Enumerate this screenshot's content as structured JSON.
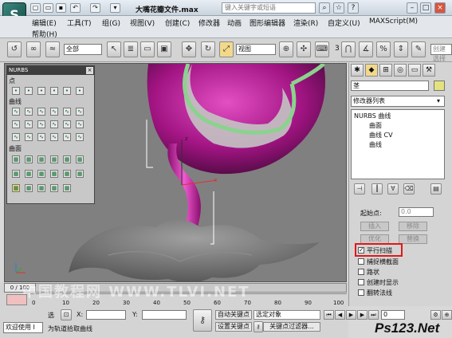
{
  "title_bar": {
    "app_logo": "S",
    "document_title": "大嘴花瓣文件.max",
    "search_placeholder": "键入关键字或短语"
  },
  "menu": {
    "items": [
      "编辑(E)",
      "工具(T)",
      "组(G)",
      "视图(V)",
      "创建(C)",
      "修改器",
      "动画",
      "图形编辑器",
      "渲染(R)",
      "自定义(U)",
      "MAXScript(M)",
      "帮助(H)"
    ]
  },
  "toolbar": {
    "selection_filter": "全部",
    "reference_coord": "视图",
    "snap_value": "3",
    "named_sets_placeholder": "创建选择集"
  },
  "nurbs_panel": {
    "title": "NURBS",
    "close": "×",
    "group_point": "点",
    "group_curve": "曲线",
    "group_surface": "曲面"
  },
  "viewport": {
    "axis_x": "x",
    "axis_y": "y",
    "axis_z": "z"
  },
  "command_panel": {
    "object_name": "茎",
    "object_color": "#e4e27e",
    "modifier_list": "修改器列表",
    "stack_root": "NURBS 曲线",
    "stack_children": [
      "曲面",
      "曲线 CV",
      "曲线"
    ],
    "start_point_label": "起始点:",
    "start_point_value": "0.0",
    "insert_button": "插入",
    "remove_button": "移除",
    "optimize_button": "优化",
    "replace_button": "替换",
    "options": [
      {
        "label": "平行扫描",
        "checked": true,
        "highlighted": true
      },
      {
        "label": "捕捉横截面",
        "checked": false
      },
      {
        "label": "路状",
        "checked": false
      },
      {
        "label": "创建时显示",
        "checked": false
      },
      {
        "label": "翻转法线",
        "checked": false
      }
    ]
  },
  "timeline": {
    "slider_label": "0 / 100",
    "ticks": [
      "0",
      "10",
      "20",
      "30",
      "40",
      "50",
      "60",
      "70",
      "80",
      "90",
      "100"
    ]
  },
  "status_bar": {
    "welcome": "欢迎使用 I",
    "selected_label": "选",
    "x_label": "X:",
    "y_label": "Y:",
    "auto_key": "自动关键点",
    "selected_object": "选定对象",
    "set_key": "设置关键点",
    "key_filters": "关键点过滤器...",
    "prompt": "为轨道拾取曲线",
    "frame_value": "0"
  },
  "watermarks": {
    "site_brand": "Ps123.Net",
    "overlay": "中国教程网 WWW.TLVI.NET"
  }
}
